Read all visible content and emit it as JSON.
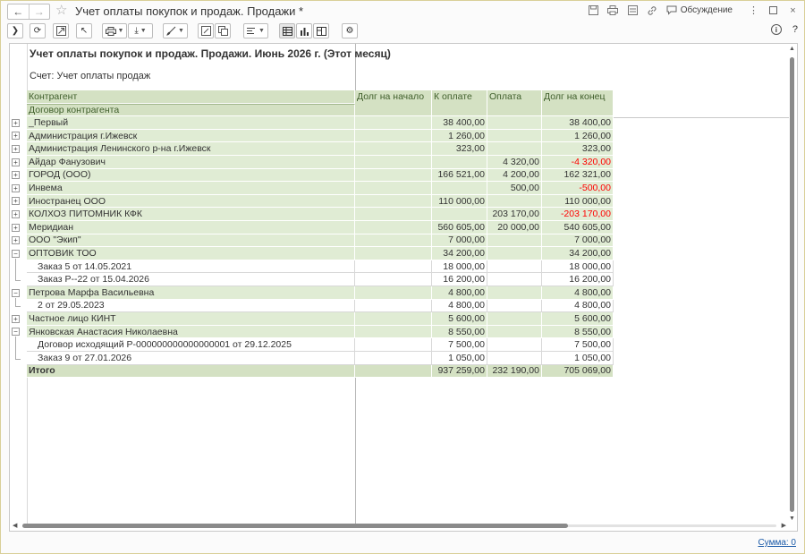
{
  "window": {
    "title": "Учет оплаты покупок и продаж. Продажи *",
    "discussion_label": "Обсуждение"
  },
  "report": {
    "title": "Учет оплаты покупок и продаж. Продажи. Июнь 2026 г. (Этот месяц)",
    "subtitle": "Счет: Учет оплаты продаж",
    "headers": {
      "counterparty": "Контрагент",
      "contract": "Договор контрагента",
      "debt_start": "Долг на начало",
      "to_pay": "К оплате",
      "payment": "Оплата",
      "debt_end": "Долг на конец"
    },
    "rows": [
      {
        "name": "_Первый",
        "level": 0,
        "expander": "+",
        "debt_start": "",
        "to_pay": "38 400,00",
        "payment": "",
        "debt_end": "38 400,00",
        "neg": false
      },
      {
        "name": "Администрация г.Ижевск",
        "level": 0,
        "expander": "+",
        "debt_start": "",
        "to_pay": "1 260,00",
        "payment": "",
        "debt_end": "1 260,00",
        "neg": false
      },
      {
        "name": "Администрация Ленинского р-на г.Ижевск",
        "level": 0,
        "expander": "+",
        "debt_start": "",
        "to_pay": "323,00",
        "payment": "",
        "debt_end": "323,00",
        "neg": false
      },
      {
        "name": "Айдар Фанузович",
        "level": 0,
        "expander": "+",
        "debt_start": "",
        "to_pay": "",
        "payment": "4 320,00",
        "debt_end": "-4 320,00",
        "neg": true
      },
      {
        "name": "ГОРОД (ООО)",
        "level": 0,
        "expander": "+",
        "debt_start": "",
        "to_pay": "166 521,00",
        "payment": "4 200,00",
        "debt_end": "162 321,00",
        "neg": false
      },
      {
        "name": "Инвема",
        "level": 0,
        "expander": "+",
        "debt_start": "",
        "to_pay": "",
        "payment": "500,00",
        "debt_end": "-500,00",
        "neg": true
      },
      {
        "name": "Иностранец ООО",
        "level": 0,
        "expander": "+",
        "debt_start": "",
        "to_pay": "110 000,00",
        "payment": "",
        "debt_end": "110 000,00",
        "neg": false
      },
      {
        "name": "КОЛХОЗ ПИТОМНИК КФК",
        "level": 0,
        "expander": "+",
        "debt_start": "",
        "to_pay": "",
        "payment": "203 170,00",
        "debt_end": "-203 170,00",
        "neg": true
      },
      {
        "name": "Меридиан",
        "level": 0,
        "expander": "+",
        "debt_start": "",
        "to_pay": "560 605,00",
        "payment": "20 000,00",
        "debt_end": "540 605,00",
        "neg": false
      },
      {
        "name": "ООО \"Экип\"",
        "level": 0,
        "expander": "+",
        "debt_start": "",
        "to_pay": "7 000,00",
        "payment": "",
        "debt_end": "7 000,00",
        "neg": false
      },
      {
        "name": "ОПТОВИК ТОО",
        "level": 0,
        "expander": "−",
        "debt_start": "",
        "to_pay": "34 200,00",
        "payment": "",
        "debt_end": "34 200,00",
        "neg": false
      },
      {
        "name": "Заказ 5 от 14.05.2021",
        "level": 1,
        "expander": "",
        "debt_start": "",
        "to_pay": "18 000,00",
        "payment": "",
        "debt_end": "18 000,00",
        "neg": false
      },
      {
        "name": "Заказ Р--22 от 15.04.2026",
        "level": 1,
        "expander": "",
        "debt_start": "",
        "to_pay": "16 200,00",
        "payment": "",
        "debt_end": "16 200,00",
        "neg": false
      },
      {
        "name": "Петрова Марфа Васильевна",
        "level": 0,
        "expander": "−",
        "debt_start": "",
        "to_pay": "4 800,00",
        "payment": "",
        "debt_end": "4 800,00",
        "neg": false
      },
      {
        "name": "2 от 29.05.2023",
        "level": 1,
        "expander": "",
        "debt_start": "",
        "to_pay": "4 800,00",
        "payment": "",
        "debt_end": "4 800,00",
        "neg": false
      },
      {
        "name": "Частное лицо КИНТ",
        "level": 0,
        "expander": "+",
        "debt_start": "",
        "to_pay": "5 600,00",
        "payment": "",
        "debt_end": "5 600,00",
        "neg": false
      },
      {
        "name": "Янковская Анастасия Николаевна",
        "level": 0,
        "expander": "−",
        "debt_start": "",
        "to_pay": "8 550,00",
        "payment": "",
        "debt_end": "8 550,00",
        "neg": false
      },
      {
        "name": "Договор исходящий Р-000000000000000001 от 29.12.2025",
        "level": 1,
        "expander": "",
        "debt_start": "",
        "to_pay": "7 500,00",
        "payment": "",
        "debt_end": "7 500,00",
        "neg": false
      },
      {
        "name": "Заказ 9 от 27.01.2026",
        "level": 1,
        "expander": "",
        "debt_start": "",
        "to_pay": "1 050,00",
        "payment": "",
        "debt_end": "1 050,00",
        "neg": false
      }
    ],
    "total": {
      "name": "Итого",
      "debt_start": "",
      "to_pay": "937 259,00",
      "payment": "232 190,00",
      "debt_end": "705 069,00"
    }
  },
  "footer": {
    "sum_label": "Сумма: 0"
  }
}
